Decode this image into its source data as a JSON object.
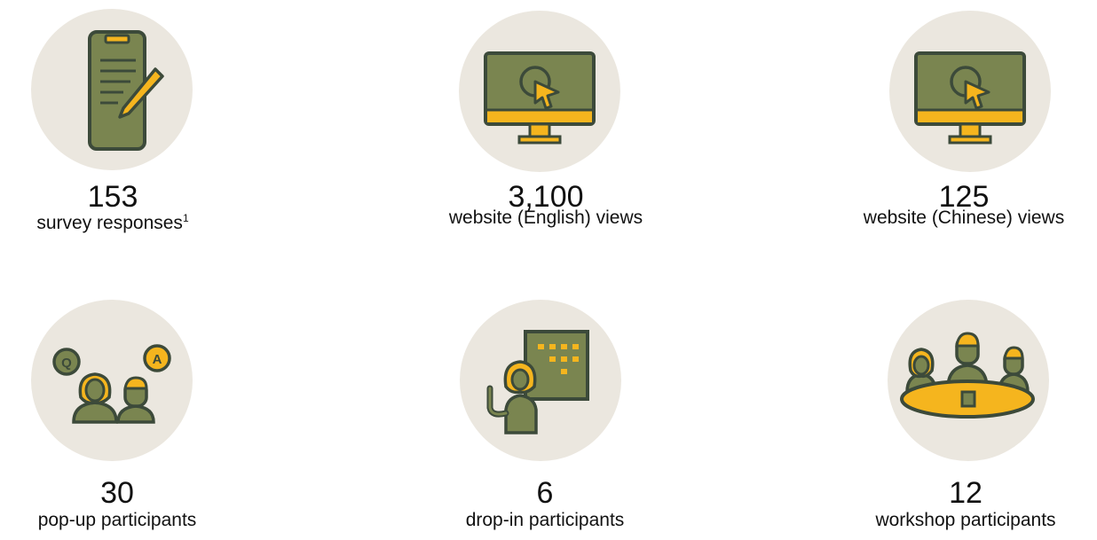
{
  "stats": [
    {
      "value": "153",
      "label": "survey responses",
      "footnote": "1",
      "icon": "tablet-pen-icon"
    },
    {
      "value": "3,100",
      "label": "website (English) views",
      "icon": "monitor-cursor-icon"
    },
    {
      "value": "125",
      "label": "website (Chinese) views",
      "icon": "monitor-cursor-icon"
    },
    {
      "value": "30",
      "label": "pop-up participants",
      "icon": "qa-people-icon"
    },
    {
      "value": "6",
      "label": "drop-in participants",
      "icon": "presenter-board-icon"
    },
    {
      "value": "12",
      "label": "workshop participants",
      "icon": "round-table-icon"
    }
  ],
  "colors": {
    "olive": "#7a8550",
    "gold": "#f5b51e",
    "outline": "#3c4a3a",
    "circle": "#ebe7df"
  }
}
